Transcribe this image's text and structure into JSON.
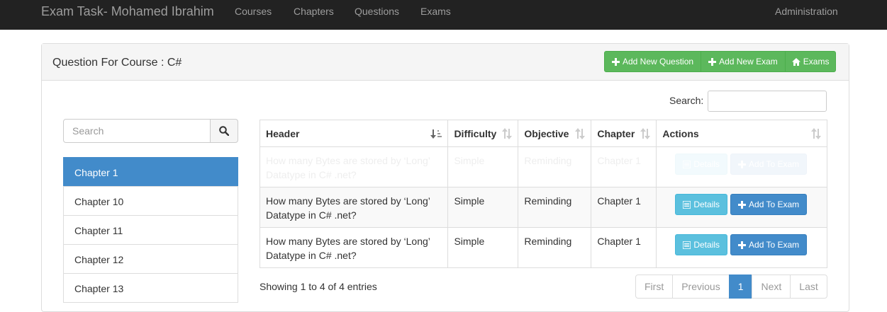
{
  "navbar": {
    "brand": "Exam Task- Mohamed Ibrahim",
    "links": [
      "Courses",
      "Chapters",
      "Questions",
      "Exams"
    ],
    "right_link": "Administration"
  },
  "panel": {
    "title": "Question For Course : C#",
    "buttons": {
      "add_question": "Add New Question",
      "add_exam": "Add New Exam",
      "exams": "Exams"
    }
  },
  "left_search": {
    "placeholder": "Search"
  },
  "chapters": [
    "Chapter 1",
    "Chapter 10",
    "Chapter 11",
    "Chapter 12",
    "Chapter 13"
  ],
  "active_chapter": "Chapter 1",
  "table_search": {
    "label": "Search:",
    "value": ""
  },
  "table": {
    "headers": [
      "Header",
      "Difficulty",
      "Objective",
      "Chapter",
      "Actions"
    ],
    "rows": [
      {
        "header_line1": "How many Bytes are stored by ‘Long’",
        "header_line2": "Datatype in C# .net?",
        "difficulty": "Simple",
        "objective": "Reminding",
        "chapter": "Chapter 1",
        "details": "Details",
        "add": "Add To Exam"
      },
      {
        "header_line1": "How many Bytes are stored by ‘Long’",
        "header_line2": "Datatype in C# .net?",
        "difficulty": "Simple",
        "objective": "Reminding",
        "chapter": "Chapter 1",
        "details": "Details",
        "add": "Add To Exam"
      },
      {
        "header_line1": "How many Bytes are stored by ‘Long’",
        "header_line2": "Datatype in C# .net?",
        "difficulty": "Simple",
        "objective": "Reminding",
        "chapter": "Chapter 1",
        "details": "Details",
        "add": "Add To Exam"
      }
    ]
  },
  "footer": {
    "showing": "Showing 1 to 4 of 4 entries",
    "pagination": [
      "First",
      "Previous",
      "1",
      "Next",
      "Last"
    ],
    "active_page": "1"
  },
  "colors": {
    "navbar": "#222222",
    "success": "#5cb85c",
    "primary": "#428bca",
    "info": "#5bc0de"
  }
}
